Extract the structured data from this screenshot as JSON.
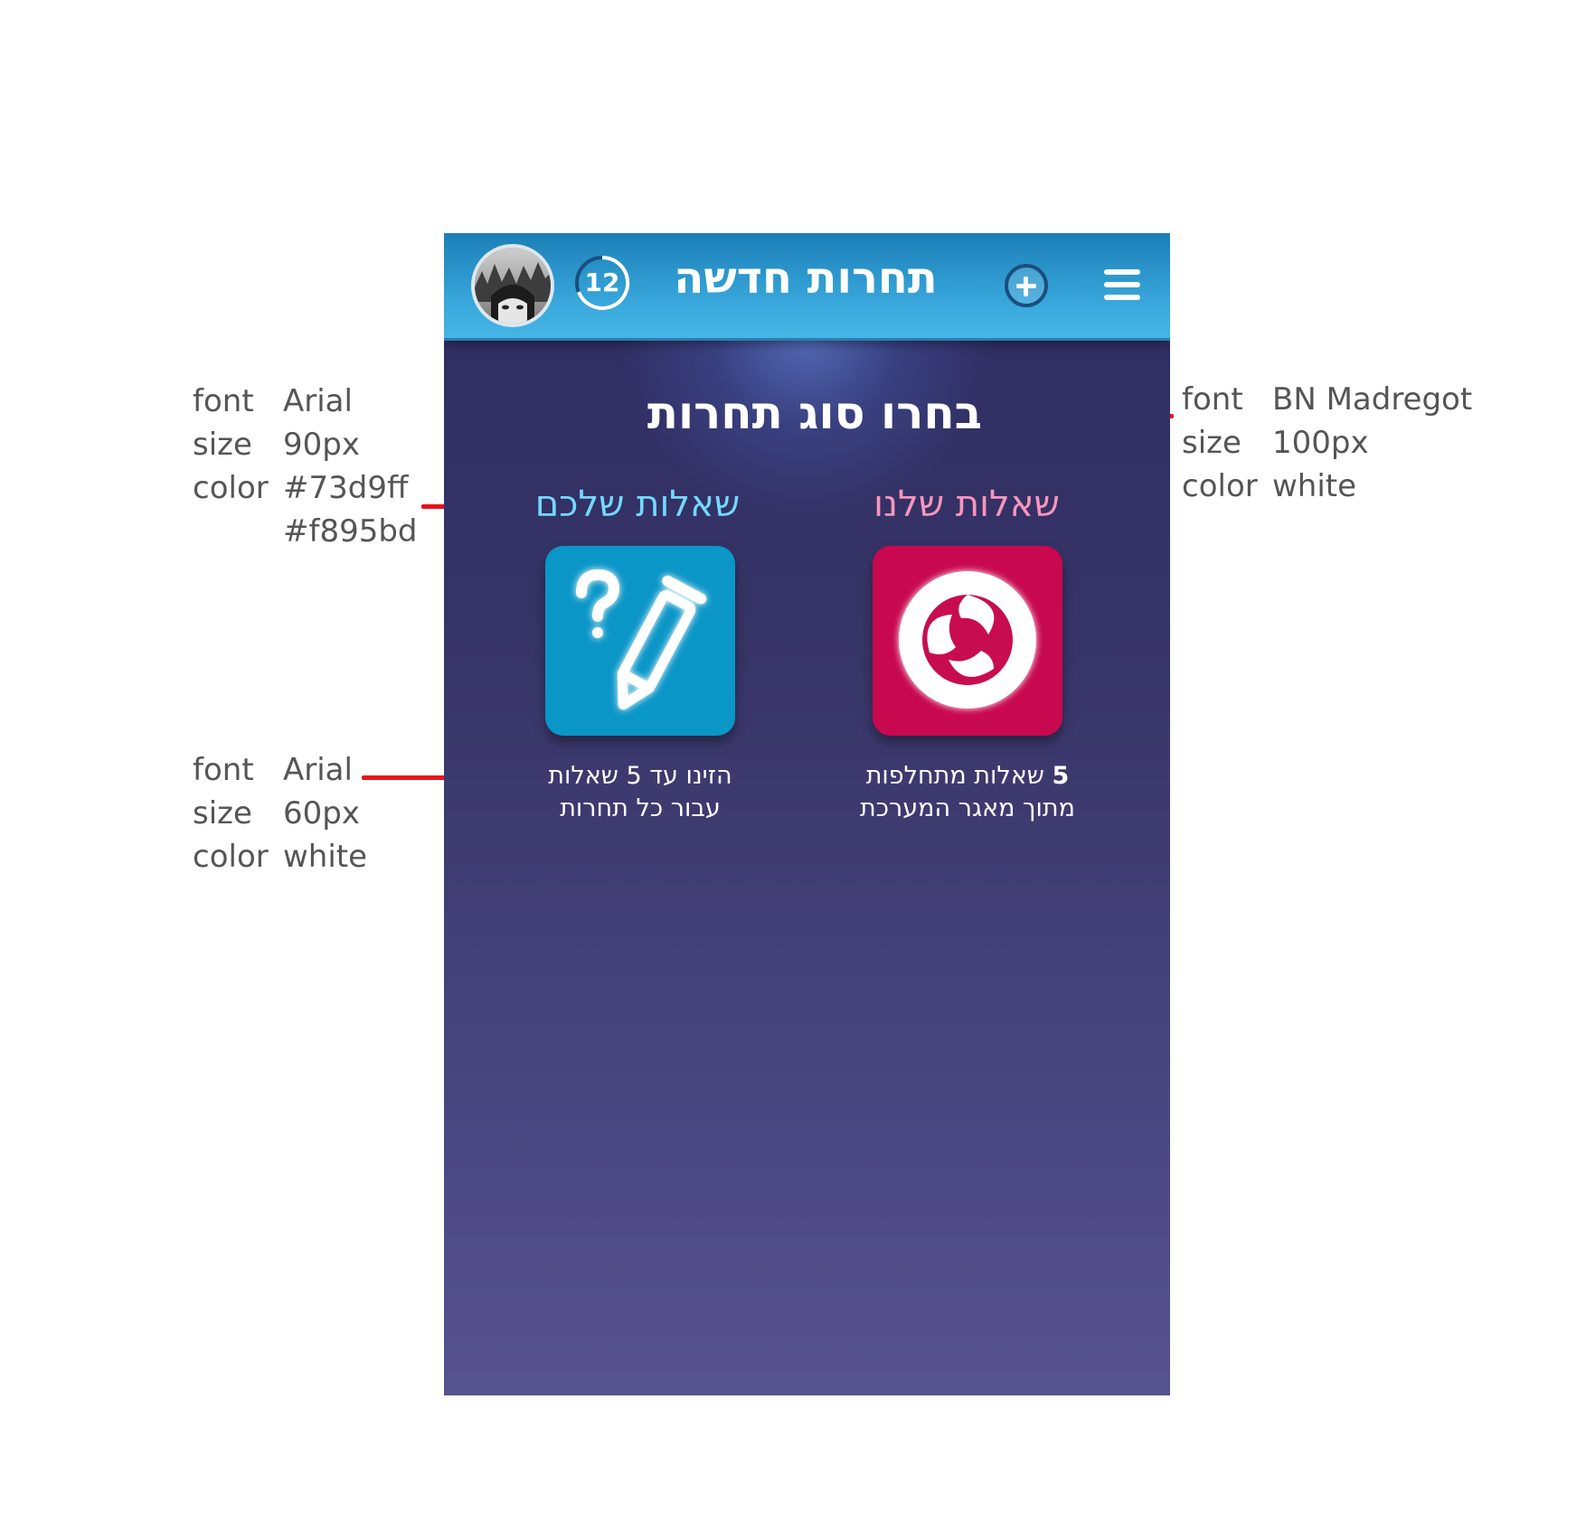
{
  "header": {
    "title": "תחרות חדשה",
    "counter": "12",
    "avatar_icon": "user-avatar",
    "add_icon": "plus-circle-icon",
    "menu_icon": "hamburger-menu-icon",
    "bar_color": "#3aa9dd"
  },
  "main": {
    "title": "בחרו סוג תחרות",
    "options": [
      {
        "label": "שאלות שלנו",
        "label_color": "#f895bd",
        "icon": "swirl-icon",
        "tile_color": "#c8084f",
        "desc_bold": "5",
        "desc_line1_rest": " שאלות מתחלפות",
        "desc_line2": "מתוך מאגר המערכת"
      },
      {
        "label": "שאלות שלכם",
        "label_color": "#73d9ff",
        "icon": "question-pencil-icon",
        "tile_color": "#0b96c8",
        "desc_line1": "הזינו עד 5 שאלות",
        "desc_line2": "עבור כל תחרות"
      }
    ]
  },
  "annotations": {
    "left_top": {
      "font_k": "font",
      "font_v": "Arial",
      "size_k": "size",
      "size_v": "90px",
      "color_k": "color",
      "color_v1": "#73d9ff",
      "color_v2": "#f895bd"
    },
    "left_bottom": {
      "font_k": "font",
      "font_v": "Arial",
      "size_k": "size",
      "size_v": "60px",
      "color_k": "color",
      "color_v": "white"
    },
    "right": {
      "font_k": "font",
      "font_v": "BN Madregot",
      "size_k": "size",
      "size_v": "100px",
      "color_k": "color",
      "color_v": "white"
    },
    "line_color": "#e8141b"
  }
}
